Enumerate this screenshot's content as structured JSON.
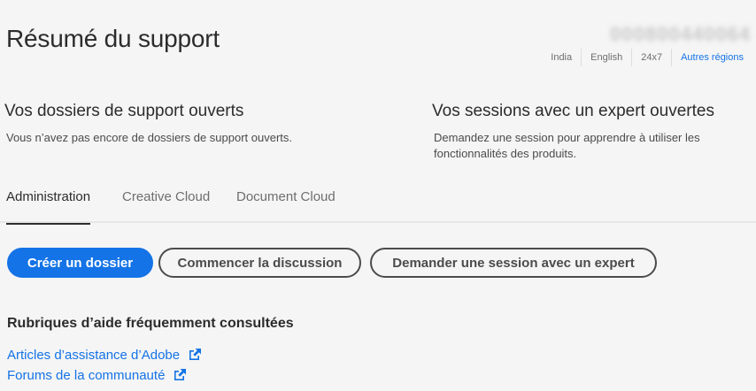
{
  "header": {
    "title": "Résumé du support",
    "phone": "000800440064",
    "meta": {
      "country": "India",
      "language": "English",
      "hours": "24x7",
      "other_regions": "Autres régions"
    }
  },
  "support_cases": {
    "heading": "Vos dossiers de support ouverts",
    "text": "Vous n’avez pas encore de dossiers de support ouverts."
  },
  "expert_sessions": {
    "heading": "Vos sessions avec un expert ouvertes",
    "text": "Demandez une session pour apprendre à utiliser les fonctionnalités des produits."
  },
  "tabs": [
    {
      "label": "Administration",
      "active": true
    },
    {
      "label": "Creative Cloud",
      "active": false
    },
    {
      "label": "Document Cloud",
      "active": false
    }
  ],
  "actions": {
    "create_case": "Créer un dossier",
    "start_chat": "Commencer la discussion",
    "request_session": "Demander une session avec un expert"
  },
  "help": {
    "heading": "Rubriques d’aide fréquemment consultées",
    "links": [
      {
        "label": "Articles d’assistance d’Adobe",
        "icon": "external-link-icon"
      },
      {
        "label": "Forums de la communauté",
        "icon": "external-link-icon"
      }
    ]
  },
  "colors": {
    "accent": "#1473e6",
    "background": "#f5f5f5",
    "text": "#2c2c2c"
  }
}
